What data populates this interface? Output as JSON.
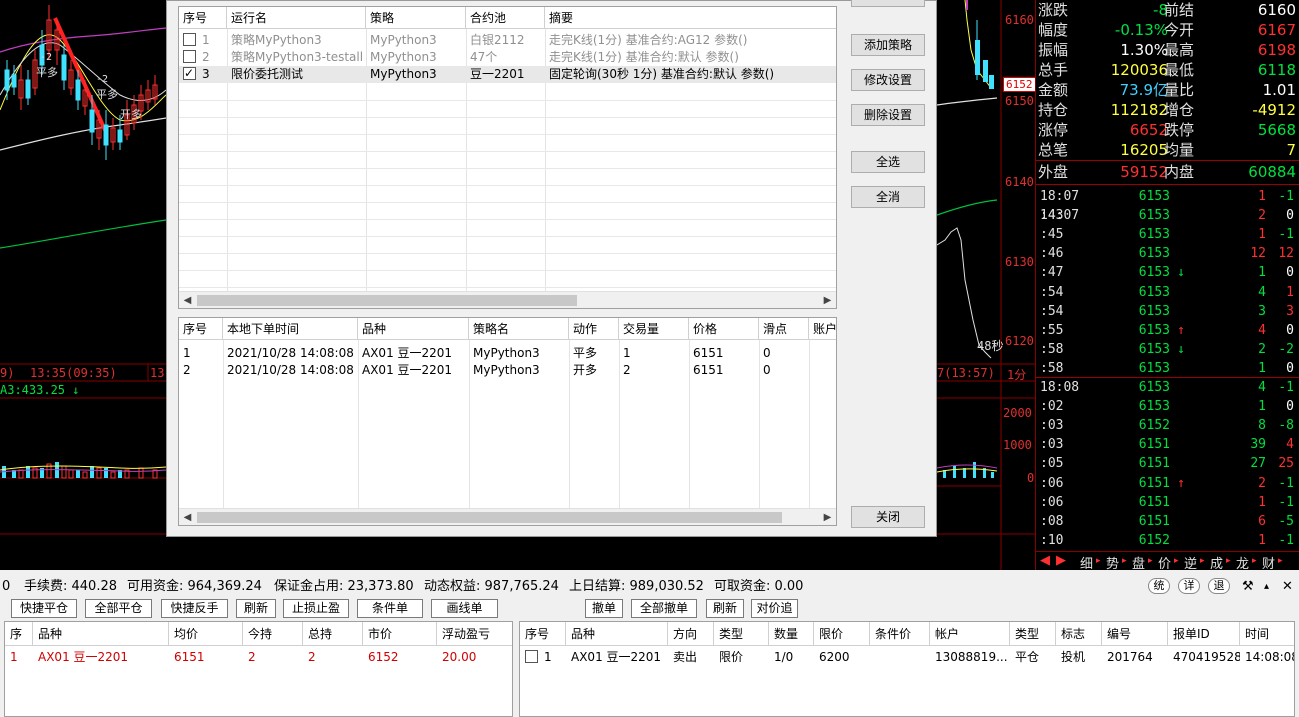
{
  "chart_left": {
    "indicator_text": "A3:433.25 ↓",
    "time_label_a": "9)",
    "time_label_b": "13:35(09:35)",
    "time_label_c": "13",
    "marker_flat_long": "平多",
    "marker_flat_long_2": "平多",
    "marker_open_long": "开多",
    "marker_value": "-2",
    "marker_value_2": "-2"
  },
  "chart_right": {
    "price_labels": [
      "6160",
      "6150",
      "6140",
      "6130",
      "6120"
    ],
    "current_price_tag": "6152",
    "vol_labels": [
      "2000",
      "1000",
      "0"
    ],
    "countdown": "48秒",
    "time_label": "7(13:57)",
    "period_label": "1分"
  },
  "quote": {
    "stats": [
      {
        "l1": "涨跌",
        "v1": "-8",
        "c1": "c-green",
        "l2": "前结",
        "v2": "6160",
        "c2": "c-white"
      },
      {
        "l1": "幅度",
        "v1": "-0.13%",
        "c1": "c-green",
        "l2": "今开",
        "v2": "6167",
        "c2": "c-red"
      },
      {
        "l1": "振幅",
        "v1": "1.30%",
        "c1": "c-white",
        "l2": "最高",
        "v2": "6198",
        "c2": "c-red"
      },
      {
        "l1": "总手",
        "v1": "120036",
        "c1": "c-yellow",
        "l2": "最低",
        "v2": "6118",
        "c2": "c-green"
      },
      {
        "l1": "金额",
        "v1": "73.9亿",
        "c1": "c-cyan",
        "l2": "量比",
        "v2": "1.01",
        "c2": "c-white"
      },
      {
        "l1": "持仓",
        "v1": "112182",
        "c1": "c-yellow",
        "l2": "增仓",
        "v2": "-4912",
        "c2": "c-yellow"
      },
      {
        "l1": "涨停",
        "v1": "6652",
        "c1": "c-red",
        "l2": "跌停",
        "v2": "5668",
        "c2": "c-green"
      },
      {
        "l1": "总笔",
        "v1": "16205",
        "c1": "c-yellow",
        "l2": "均量",
        "v2": "7",
        "c2": "c-yellow"
      }
    ],
    "outer_label": "外盘",
    "outer_value": "59152",
    "inner_label": "内盘",
    "inner_value": "60884",
    "ticks": [
      {
        "time": "18:07 14:07",
        "price": "6153",
        "arrow": "",
        "vol": "1",
        "vc": "c-red",
        "chg": "-1",
        "cc": "c-green"
      },
      {
        "time": ":43",
        "price": "6153",
        "arrow": "",
        "vol": "2",
        "vc": "c-red",
        "chg": "0",
        "cc": "c-white"
      },
      {
        "time": ":45",
        "price": "6153",
        "arrow": "",
        "vol": "1",
        "vc": "c-red",
        "chg": "-1",
        "cc": "c-green"
      },
      {
        "time": ":46",
        "price": "6153",
        "arrow": "",
        "vol": "12",
        "vc": "c-red",
        "chg": "12",
        "cc": "c-red"
      },
      {
        "time": ":47",
        "price": "6153",
        "arrow": "↓",
        "ac": "c-green",
        "vol": "1",
        "vc": "c-green",
        "chg": "0",
        "cc": "c-white"
      },
      {
        "time": ":54",
        "price": "6153",
        "arrow": "",
        "vol": "4",
        "vc": "c-green",
        "chg": "1",
        "cc": "c-red"
      },
      {
        "time": ":54",
        "price": "6153",
        "arrow": "",
        "vol": "3",
        "vc": "c-green",
        "chg": "3",
        "cc": "c-red"
      },
      {
        "time": ":55",
        "price": "6153",
        "arrow": "↑",
        "ac": "c-red",
        "vol": "4",
        "vc": "c-red",
        "chg": "0",
        "cc": "c-white"
      },
      {
        "time": ":58",
        "price": "6153",
        "arrow": "↓",
        "ac": "c-green",
        "vol": "2",
        "vc": "c-green",
        "chg": "-2",
        "cc": "c-green"
      },
      {
        "time": ":58",
        "price": "6153",
        "arrow": "",
        "vol": "1",
        "vc": "c-green",
        "chg": "0",
        "cc": "c-white"
      },
      {
        "time": "18:08",
        "price": "6153",
        "arrow": "",
        "vol": "4",
        "vc": "c-green",
        "chg": "-1",
        "cc": "c-green"
      },
      {
        "time": ":02",
        "price": "6153",
        "arrow": "",
        "vol": "1",
        "vc": "c-green",
        "chg": "0",
        "cc": "c-white"
      },
      {
        "time": ":03",
        "price": "6152",
        "arrow": "",
        "vol": "8",
        "vc": "c-green",
        "chg": "-8",
        "cc": "c-green"
      },
      {
        "time": ":03",
        "price": "6151",
        "arrow": "",
        "vol": "39",
        "vc": "c-green",
        "chg": "4",
        "cc": "c-red"
      },
      {
        "time": ":05",
        "price": "6151",
        "arrow": "",
        "vol": "27",
        "vc": "c-green",
        "chg": "25",
        "cc": "c-red"
      },
      {
        "time": ":06",
        "price": "6151",
        "arrow": "↑",
        "ac": "c-red",
        "vol": "2",
        "vc": "c-red",
        "chg": "-1",
        "cc": "c-green"
      },
      {
        "time": ":06",
        "price": "6151",
        "arrow": "",
        "vol": "1",
        "vc": "c-red",
        "chg": "-1",
        "cc": "c-green"
      },
      {
        "time": ":08",
        "price": "6151",
        "arrow": "",
        "vol": "6",
        "vc": "c-red",
        "chg": "-5",
        "cc": "c-green"
      },
      {
        "time": ":10",
        "price": "6152",
        "arrow": "",
        "vol": "1",
        "vc": "c-red",
        "chg": "-1",
        "cc": "c-green"
      }
    ],
    "tabs": [
      "细",
      "势",
      "盘",
      "价",
      "逆",
      "成",
      "龙",
      "财"
    ]
  },
  "dialog": {
    "strategy_grid": {
      "headers": [
        "序号",
        "运行名",
        "策略",
        "合约池",
        "摘要"
      ],
      "rows": [
        {
          "checked": false,
          "no": "1",
          "name": "策略MyPython3",
          "strategy": "MyPython3",
          "pool": "白银2112",
          "summary": "走完K线(1分) 基准合约:AG12 参数()"
        },
        {
          "checked": false,
          "no": "2",
          "name": "策略MyPython3-testall",
          "strategy": "MyPython3",
          "pool": "47个",
          "summary": "走完K线(1分) 基准合约:默认 参数()"
        },
        {
          "checked": true,
          "no": "3",
          "name": "限价委托测试",
          "strategy": "MyPython3",
          "pool": "豆一2201",
          "summary": "固定轮询(30秒 1分) 基准合约:默认 参数()"
        }
      ]
    },
    "order_grid": {
      "headers": [
        "序号",
        "本地下单时间",
        "品种",
        "策略名",
        "动作",
        "交易量",
        "价格",
        "滑点",
        "账户"
      ],
      "rows": [
        {
          "no": "1",
          "time": "2021/10/28 14:08:08",
          "symbol": "AX01 豆一2201",
          "strategy": "MyPython3",
          "action": "平多",
          "qty": "1",
          "price": "6151",
          "slip": "0"
        },
        {
          "no": "2",
          "time": "2021/10/28 14:08:08",
          "symbol": "AX01 豆一2201",
          "strategy": "MyPython3",
          "action": "开多",
          "qty": "2",
          "price": "6151",
          "slip": "0"
        }
      ]
    },
    "buttons": {
      "add": "添加策略",
      "modify": "修改设置",
      "delete": "删除设置",
      "select_all": "全选",
      "deselect_all": "全消",
      "close": "关闭"
    }
  },
  "account": {
    "leading": "0",
    "fee": "手续费: 440.28",
    "available": "可用资金: 964,369.24",
    "margin": "保证金占用: 23,373.80",
    "equity": "动态权益: 987,765.24",
    "settle": "上日结算: 989,030.52",
    "withdrawable": "可取资金: 0.00",
    "ctl_tong": "统",
    "ctl_xiang": "详",
    "ctl_tui": "退"
  },
  "toolbar_left": [
    "快捷平仓",
    "全部平仓",
    "快捷反手",
    "刷新",
    "止损止盈",
    "条件单",
    "画线单"
  ],
  "toolbar_right": [
    "撤单",
    "全部撤单",
    "刷新",
    "对价追"
  ],
  "positions": {
    "headers": [
      "序",
      "品种",
      "均价",
      "今持",
      "总持",
      "市价",
      "浮动盈亏"
    ],
    "rows": [
      {
        "no": "1",
        "symbol": "AX01 豆一2201",
        "avg": "6151",
        "today": "2",
        "total": "2",
        "market": "6152",
        "pnl": "20.00"
      }
    ]
  },
  "orders": {
    "headers": [
      "序号",
      "品种",
      "方向",
      "类型",
      "数量",
      "限价",
      "条件价",
      "帐户",
      "类型",
      "标志",
      "编号",
      "报单ID",
      "时间"
    ],
    "rows": [
      {
        "no": "1",
        "symbol": "AX01 豆一2201",
        "dir": "卖出",
        "type": "限价",
        "qty": "1/0",
        "limit": "6200",
        "cond": "",
        "account": "13088819...",
        "type2": "平仓",
        "flag": "投机",
        "num": "201764",
        "order_id": "470419528",
        "time": "14:08:08"
      }
    ]
  }
}
